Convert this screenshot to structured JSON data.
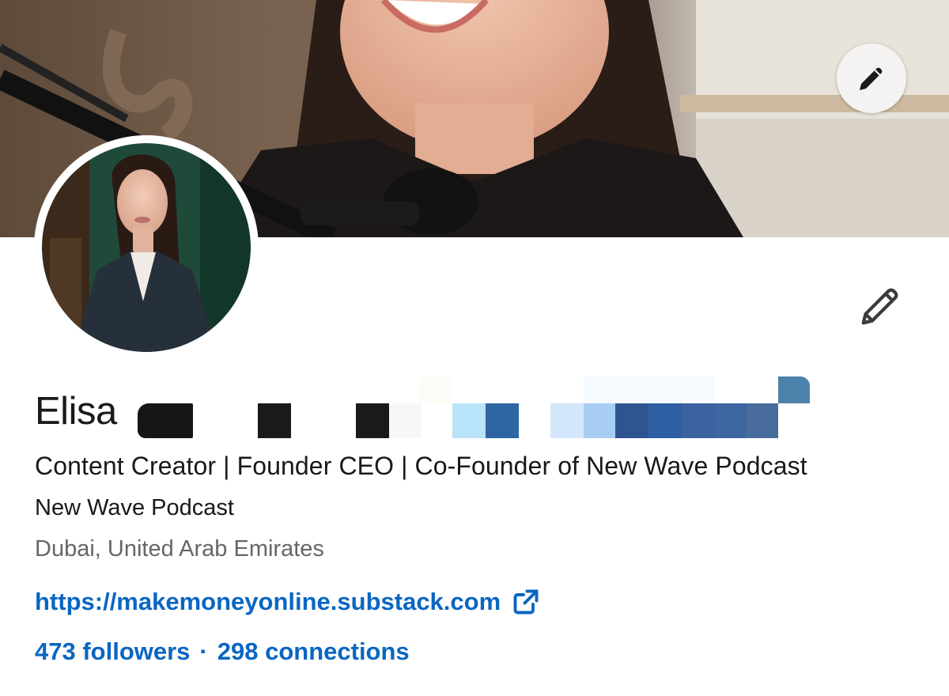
{
  "cover": {
    "edit_icon": "pencil-icon"
  },
  "intro": {
    "edit_icon": "pencil-icon"
  },
  "profile": {
    "first_name": "Elisa",
    "headline": "Content Creator | Founder CEO | Co-Founder of New Wave Podcast",
    "company": "New Wave Podcast",
    "location": "Dubai, United Arab Emirates",
    "website": "https://makemoneyonline.substack.com",
    "followers": "473 followers",
    "separator": "·",
    "connections": "298 connections"
  },
  "colors": {
    "link_blue": "#0a66c2",
    "text_primary": "#191919",
    "text_secondary": "#666666"
  }
}
